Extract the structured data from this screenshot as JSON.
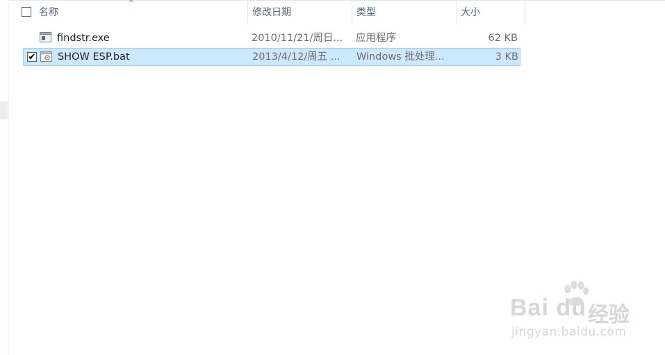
{
  "header": {
    "sort_arrow": "^",
    "columns": {
      "name": "名称",
      "date": "修改日期",
      "type": "类型",
      "size": "大小"
    }
  },
  "files": [
    {
      "name": "findstr.exe",
      "modified": "2010/11/21/周日...",
      "type": "应用程序",
      "size": "62 KB",
      "icon": "exe-app-icon",
      "selected": false,
      "checked": false
    },
    {
      "name": "SHOW ESP.bat",
      "modified": "2013/4/12/周五 ...",
      "type": "Windows 批处理...",
      "size": "3 KB",
      "icon": "batch-file-icon",
      "selected": true,
      "checked": true,
      "check_glyph": "✔"
    }
  ],
  "watermark": {
    "brand": "Bai du",
    "jingyan": "经验",
    "url": "jingyan.baidu.com"
  },
  "colors": {
    "selection_bg": "#cce8ff",
    "selection_border": "#99d1ff",
    "header_text": "#4c607a"
  }
}
